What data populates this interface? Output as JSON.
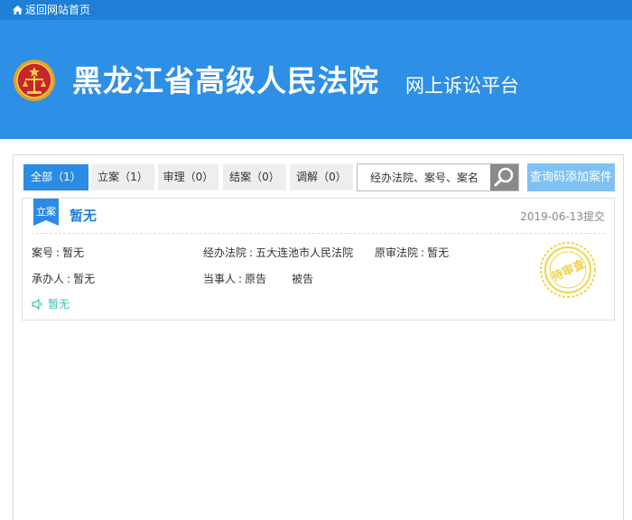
{
  "topbar": {
    "back_home": "返回网站首页"
  },
  "header": {
    "court_name": "黑龙江省高级人民法院",
    "platform": "网上诉讼平台"
  },
  "tabs": [
    {
      "label": "全部（1）",
      "active": true
    },
    {
      "label": "立案（1）",
      "active": false
    },
    {
      "label": "审理（0）",
      "active": false
    },
    {
      "label": "结案（0）",
      "active": false
    },
    {
      "label": "调解（0）",
      "active": false
    }
  ],
  "search": {
    "placeholder": "经办法院、案号、案名"
  },
  "add_case_button": "查询码添加案件",
  "case": {
    "status_tag": "立案",
    "title": "暂无",
    "submitted": "2019-06-13提交",
    "case_no_label": "案号",
    "case_no": "暂无",
    "court_label": "经办法院",
    "court": "五大连池市人民法院",
    "original_court_label": "原审法院",
    "original_court": "暂无",
    "judge_label": "承办人",
    "judge": "暂无",
    "parties_label": "当事人",
    "plaintiff": "原告",
    "defendant": "被告",
    "notice": "暂无",
    "stamp_text": "待审查"
  },
  "colors": {
    "header": "#2e8fe6",
    "topbar": "#1f7fd6",
    "active_tab": "#2c8be3",
    "stamp": "#f0d44a"
  },
  "icons": {
    "topbar": "home-icon",
    "search": "search-icon",
    "notice": "speaker-icon",
    "emblem": "court-emblem-icon"
  }
}
